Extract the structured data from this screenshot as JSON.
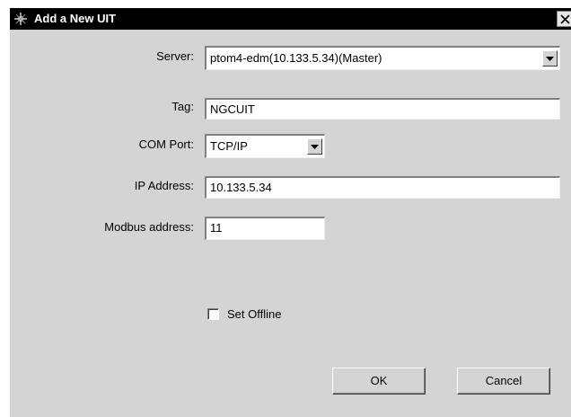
{
  "window": {
    "title": "Add a New UIT",
    "close_glyph": "X"
  },
  "form": {
    "server_label": "Server:",
    "server_value": "ptom4-edm(10.133.5.34)(Master)",
    "tag_label": "Tag:",
    "tag_value": "NGCUIT",
    "comport_label": "COM Port:",
    "comport_value": "TCP/IP",
    "ip_label": "IP Address:",
    "ip_value": "10.133.5.34",
    "modbus_label": "Modbus address:",
    "modbus_value": "11",
    "offline_label": "Set Offline",
    "offline_checked": false
  },
  "buttons": {
    "ok": "OK",
    "cancel": "Cancel"
  },
  "icons": {
    "title": "app-icon",
    "close": "close-icon",
    "dropdown": "chevron-down-icon"
  }
}
